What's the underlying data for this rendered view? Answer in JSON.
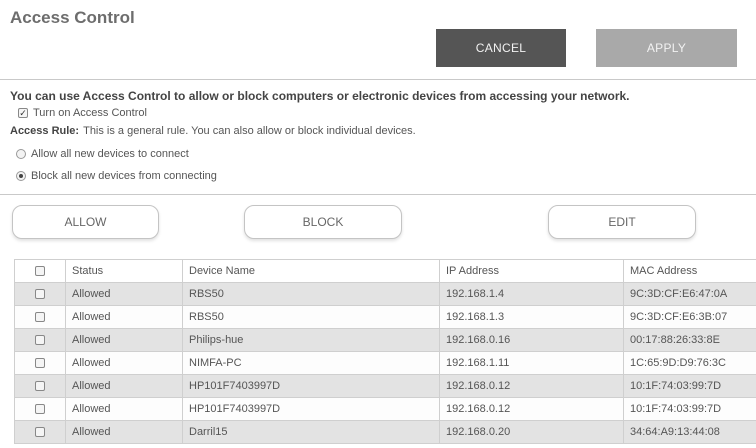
{
  "page": {
    "title": "Access Control"
  },
  "actions": {
    "cancel": "CANCEL",
    "apply": "APPLY"
  },
  "intro": "You can use Access Control to allow or block computers or electronic devices from accessing your network.",
  "turn_on": {
    "label": "Turn on Access Control",
    "checked": true
  },
  "access_rule": {
    "label": "Access Rule:",
    "text": "This is a general rule. You can also allow or block individual devices.",
    "options": [
      {
        "label": "Allow all new devices to connect",
        "selected": false
      },
      {
        "label": "Block all new devices from connecting",
        "selected": true
      }
    ]
  },
  "buttons": {
    "allow": "ALLOW",
    "block": "BLOCK",
    "edit": "EDIT"
  },
  "table": {
    "headers": {
      "status": "Status",
      "device": "Device Name",
      "ip": "IP Address",
      "mac": "MAC Address"
    },
    "rows": [
      {
        "status": "Allowed",
        "device": "RBS50",
        "ip": "192.168.1.4",
        "mac": "9C:3D:CF:E6:47:0A"
      },
      {
        "status": "Allowed",
        "device": "RBS50",
        "ip": "192.168.1.3",
        "mac": "9C:3D:CF:E6:3B:07"
      },
      {
        "status": "Allowed",
        "device": "Philips-hue",
        "ip": "192.168.0.16",
        "mac": "00:17:88:26:33:8E"
      },
      {
        "status": "Allowed",
        "device": "NIMFA-PC",
        "ip": "192.168.1.11",
        "mac": "1C:65:9D:D9:76:3C"
      },
      {
        "status": "Allowed",
        "device": "HP101F7403997D",
        "ip": "192.168.0.12",
        "mac": "10:1F:74:03:99:7D"
      },
      {
        "status": "Allowed",
        "device": "HP101F7403997D",
        "ip": "192.168.0.12",
        "mac": "10:1F:74:03:99:7D"
      },
      {
        "status": "Allowed",
        "device": "Darril15",
        "ip": "192.168.0.20",
        "mac": "34:64:A9:13:44:08"
      }
    ]
  },
  "colors": {
    "cancel_bg": "#555555",
    "apply_bg": "#a9a9a9",
    "row_shade": "#e3e3e3"
  }
}
